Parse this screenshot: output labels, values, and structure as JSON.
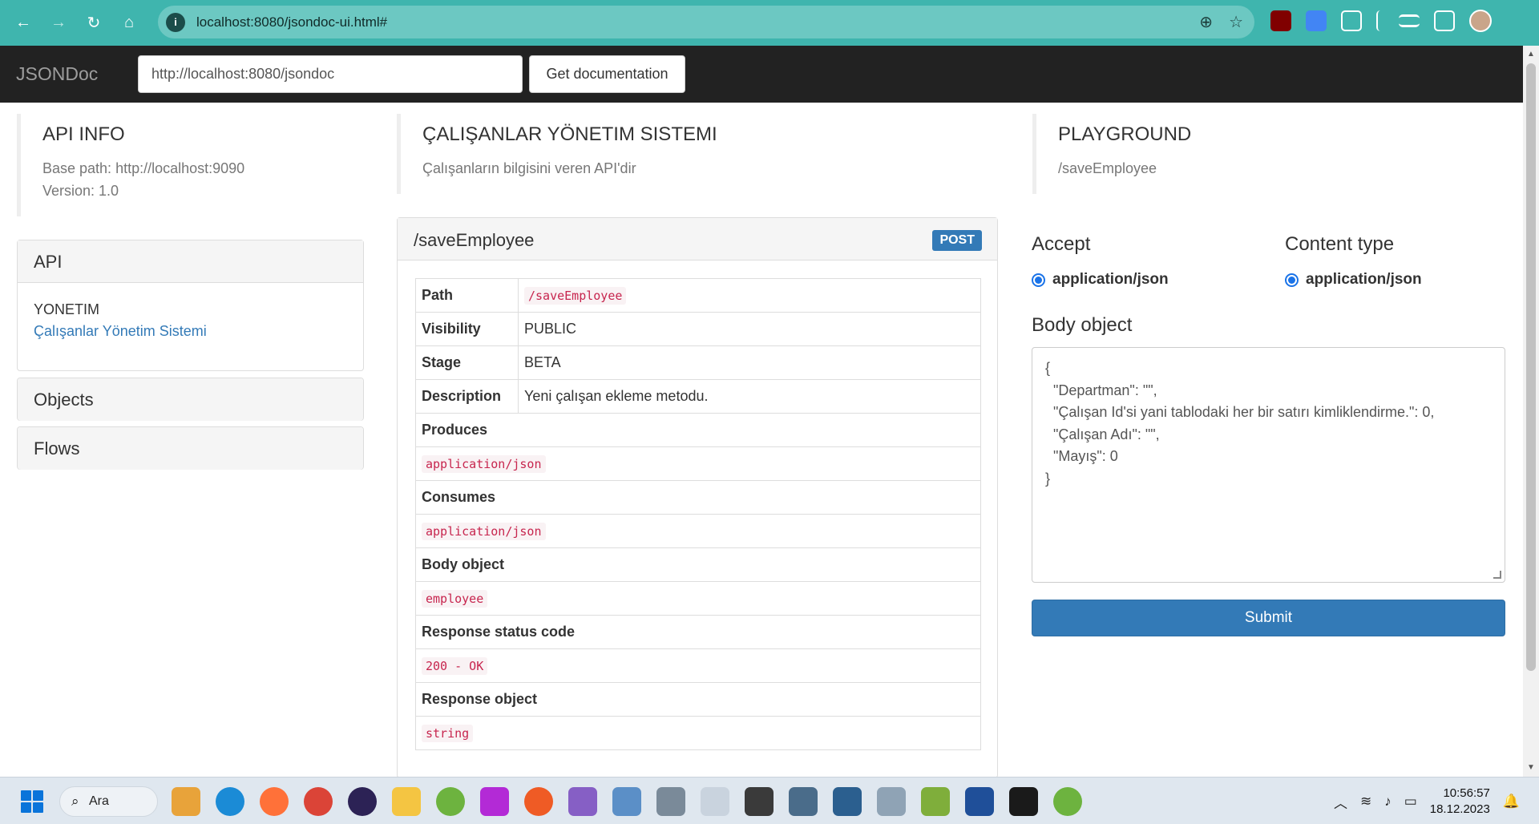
{
  "browser": {
    "url": "localhost:8080/jsondoc-ui.html#",
    "info_glyph": "i",
    "back_icon": "←",
    "forward_icon": "→",
    "reload_icon": "↻",
    "home_icon": "⌂",
    "zoom_icon": "⊕",
    "star_icon": "☆"
  },
  "navbar": {
    "brand": "JSONDoc",
    "url_value": "http://localhost:8080/jsondoc",
    "get_doc_label": "Get documentation"
  },
  "api_info": {
    "title": "API INFO",
    "base_path": "Base path: http://localhost:9090",
    "version": "Version: 1.0"
  },
  "system": {
    "title": "ÇALIŞANLAR YÖNETIM SISTEMI",
    "description": "Çalışanların bilgisini veren API'dir"
  },
  "playground": {
    "title": "PLAYGROUND",
    "path": "/saveEmployee",
    "accept_label": "Accept",
    "accept_value": "application/json",
    "content_type_label": "Content type",
    "content_type_value": "application/json",
    "body_label": "Body object",
    "body_text": "{\n  \"Departman\": \"\",\n  \"Çalışan Id'si yani tablodaki her bir satırı kimliklendirme.\": 0,\n  \"Çalışan Adı\": \"\",\n  \"Mayış\": 0\n}",
    "submit_label": "Submit"
  },
  "sidebar": {
    "api_heading": "API",
    "group_name": "YONETIM",
    "group_link": "Çalışanlar Yönetim Sistemi",
    "objects_heading": "Objects",
    "flows_heading": "Flows"
  },
  "method": {
    "path": "/saveEmployee",
    "verb": "POST",
    "rows": {
      "path_key": "Path",
      "path_val": "/saveEmployee",
      "visibility_key": "Visibility",
      "visibility_val": "PUBLIC",
      "stage_key": "Stage",
      "stage_val": "BETA",
      "description_key": "Description",
      "description_val": "Yeni çalışan ekleme metodu.",
      "produces_key": "Produces",
      "produces_val": "application/json",
      "consumes_key": "Consumes",
      "consumes_val": "application/json",
      "body_key": "Body object",
      "body_val": "employee",
      "status_key": "Response status code",
      "status_val": "200 - OK",
      "response_key": "Response object",
      "response_val": "string"
    }
  },
  "taskbar": {
    "search_label": "Ara",
    "time": "10:56:57",
    "date": "18.12.2023"
  },
  "colors": {
    "browser_frame": "#3fb5ae",
    "navbar": "#222222",
    "primary": "#337ab7",
    "code": "#c7254e"
  }
}
